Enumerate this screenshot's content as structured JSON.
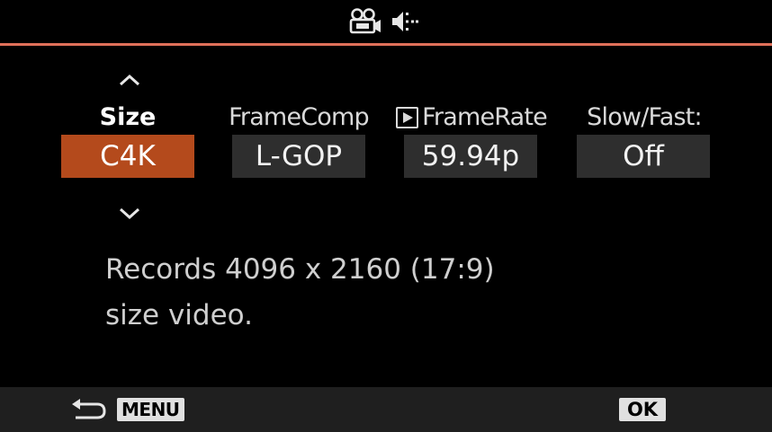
{
  "header": {
    "icons": [
      "movie-camera-icon",
      "audio-input-icon"
    ]
  },
  "settings": [
    {
      "label": "Size",
      "value": "C4K",
      "selected": true
    },
    {
      "label": "FrameComp",
      "value": "L-GOP",
      "selected": false
    },
    {
      "label": "FrameRate",
      "value": "59.94p",
      "selected": false,
      "label_icon": "play-box-icon"
    },
    {
      "label": "Slow/Fast:",
      "value": "Off",
      "selected": false
    }
  ],
  "description": {
    "line1": "Records 4096 x 2160 (17:9)",
    "line2": "size video."
  },
  "footer": {
    "menu_label": "MENU",
    "ok_label": "OK"
  },
  "colors": {
    "accent_rule": "#e0705a",
    "selected_bg": "#b44a1c",
    "value_bg": "#2e2e2e",
    "footer_bg": "#1f1f1f"
  }
}
